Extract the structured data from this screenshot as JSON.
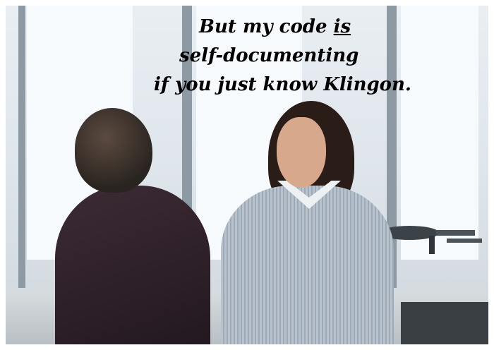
{
  "meme": {
    "caption_line1_before": "But my code ",
    "caption_line1_emph": "is",
    "caption_line2": "self-documenting",
    "caption_line3": "if you just know Klingon."
  },
  "scene": {
    "subject_left": "man",
    "subject_right": "woman",
    "prop": "starship-model",
    "colors": {
      "background": "#e9eef2",
      "man_shirt": "#2f2129",
      "woman_shirt": "#aab5bf",
      "hair": "#2a1c17"
    }
  }
}
